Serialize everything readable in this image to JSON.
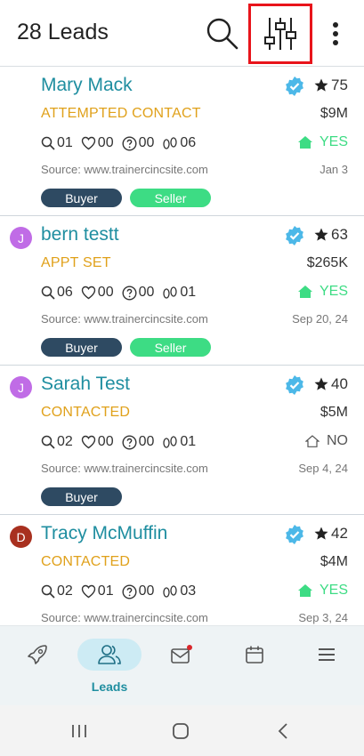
{
  "header": {
    "title": "28 Leads"
  },
  "colors": {
    "name": "#1f8ea0",
    "status": "#e0a11b",
    "yes": "#3ddc84",
    "buyer": "#2e4a62",
    "seller": "#3ddc84",
    "highlight": "#e8141b"
  },
  "leads": [
    {
      "initial": "",
      "name": "Mary Mack",
      "score": "75",
      "status": "ATTEMPTED CONTACT",
      "price": "$9M",
      "views": "01",
      "favorites": "00",
      "questions": "00",
      "visits": "06",
      "home_status": "YES",
      "source": "Source: www.trainercincsite.com",
      "date": "Jan 3",
      "tags": [
        "Buyer",
        "Seller"
      ]
    },
    {
      "initial": "J",
      "name": "bern testt",
      "score": "63",
      "status": "APPT SET",
      "price": "$265K",
      "views": "06",
      "favorites": "00",
      "questions": "00",
      "visits": "01",
      "home_status": "YES",
      "source": "Source: www.trainercincsite.com",
      "date": "Sep 20, 24",
      "tags": [
        "Buyer",
        "Seller"
      ]
    },
    {
      "initial": "J",
      "name": "Sarah Test",
      "score": "40",
      "status": "CONTACTED",
      "price": "$5M",
      "views": "02",
      "favorites": "00",
      "questions": "00",
      "visits": "01",
      "home_status": "NO",
      "source": "Source: www.trainercincsite.com",
      "date": "Sep 4, 24",
      "tags": [
        "Buyer"
      ]
    },
    {
      "initial": "D",
      "name": "Tracy McMuffin",
      "score": "42",
      "status": "CONTACTED",
      "price": "$4M",
      "views": "02",
      "favorites": "01",
      "questions": "00",
      "visits": "03",
      "home_status": "YES",
      "source": "Source: www.trainercincsite.com",
      "date": "Sep 3, 24",
      "tags": []
    }
  ],
  "bottom_nav": {
    "items": [
      {
        "icon": "rocket-icon",
        "label": ""
      },
      {
        "icon": "leads-icon",
        "label": "Leads",
        "active": true
      },
      {
        "icon": "mail-icon",
        "label": "",
        "notification": true
      },
      {
        "icon": "calendar-icon",
        "label": ""
      },
      {
        "icon": "menu-icon",
        "label": ""
      }
    ]
  }
}
